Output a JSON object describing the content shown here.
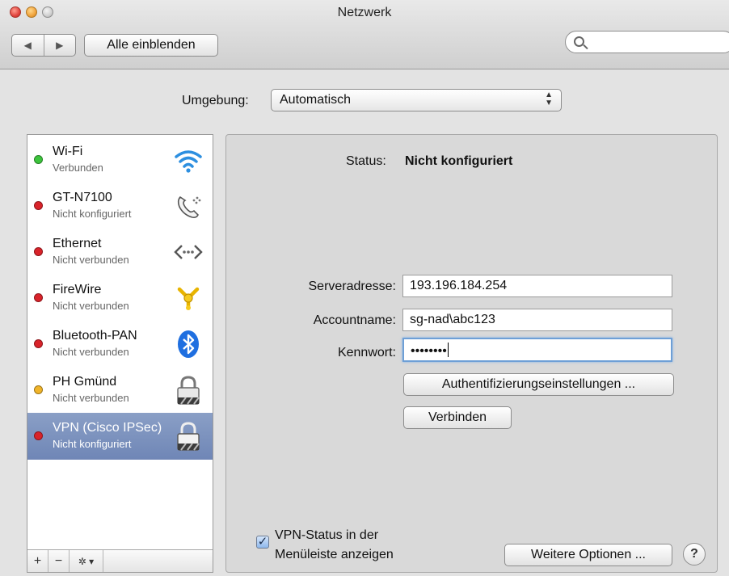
{
  "window": {
    "title": "Netzwerk"
  },
  "toolbar": {
    "back_glyph": "◀",
    "forward_glyph": "▶",
    "show_all_label": "Alle einblenden",
    "search_placeholder": ""
  },
  "location": {
    "label": "Umgebung:",
    "value": "Automatisch"
  },
  "services": [
    {
      "name": "Wi-Fi",
      "status": "Verbunden",
      "dot": "#3cc43c",
      "icon": "wifi-icon"
    },
    {
      "name": "GT-N7100",
      "status": "Nicht konfiguriert",
      "dot": "#d9232a",
      "icon": "phone-icon"
    },
    {
      "name": "Ethernet",
      "status": "Nicht verbunden",
      "dot": "#d9232a",
      "icon": "ethernet-icon"
    },
    {
      "name": "FireWire",
      "status": "Nicht verbunden",
      "dot": "#d9232a",
      "icon": "firewire-icon"
    },
    {
      "name": "Bluetooth-PAN",
      "status": "Nicht verbunden",
      "dot": "#d9232a",
      "icon": "bluetooth-icon"
    },
    {
      "name": "PH Gmünd",
      "status": "Nicht verbunden",
      "dot": "#f0b429",
      "icon": "lock-icon"
    },
    {
      "name": "VPN (Cisco IPSec)",
      "status": "Nicht konfiguriert",
      "dot": "#d9232a",
      "icon": "lock-icon",
      "selected": true
    }
  ],
  "list_controls": {
    "add": "+",
    "remove": "−",
    "action": "✲ ▾"
  },
  "detail": {
    "status_label": "Status:",
    "status_value": "Nicht konfiguriert",
    "server_label": "Serveradresse:",
    "server_value": "193.196.184.254",
    "account_label": "Accountname:",
    "account_value": "sg-nad\\abc123",
    "password_label": "Kennwort:",
    "password_value": "••••••••",
    "auth_button": "Authentifizierungseinstellungen ...",
    "connect_button": "Verbinden",
    "show_status_label": "VPN-Status in der Menüleiste anzeigen",
    "show_status_checked": true,
    "more_options_button": "Weitere Optionen ...",
    "help_glyph": "?"
  },
  "colors": {
    "selection": "#7589b8",
    "focus_ring": "#6e9fd6"
  }
}
